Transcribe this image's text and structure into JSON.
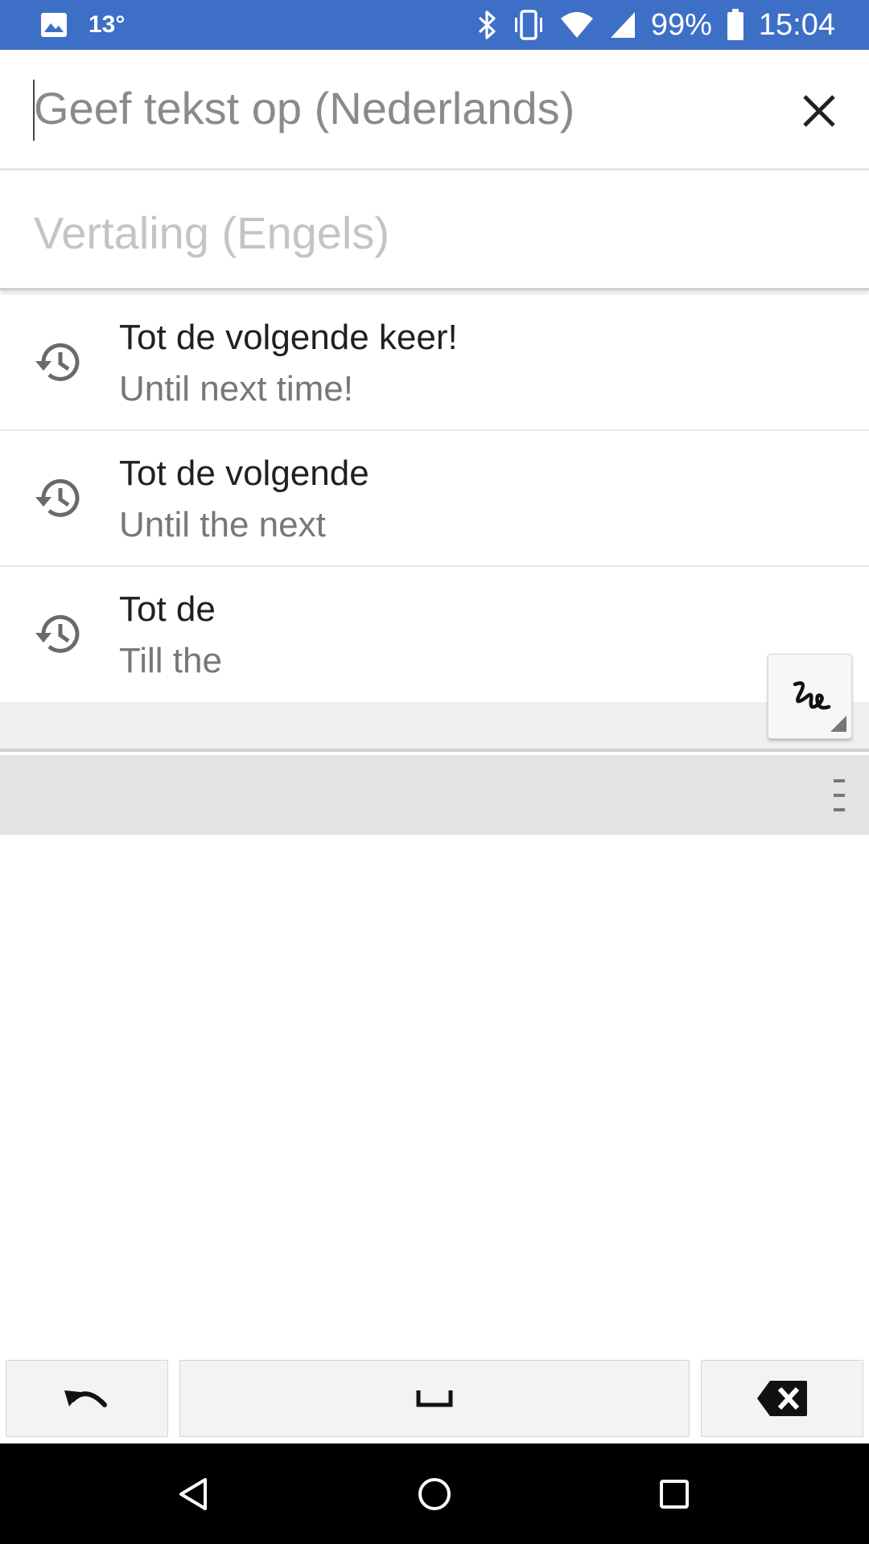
{
  "status_bar": {
    "temperature": "13°",
    "battery": "99%",
    "time": "15:04",
    "icons": [
      "image-icon",
      "bluetooth-icon",
      "vibrate-icon",
      "wifi-icon",
      "signal-icon",
      "battery-icon"
    ],
    "background_color": "#3d6fc6"
  },
  "input": {
    "placeholder": "Geef tekst op (Nederlands)",
    "value": "",
    "clear_icon": "close-icon"
  },
  "translation": {
    "placeholder": "Vertaling (Engels)"
  },
  "history": [
    {
      "source": "Tot de volgende keer!",
      "translation": "Until next time!",
      "icon": "history-icon"
    },
    {
      "source": "Tot de volgende",
      "translation": "Until the next",
      "icon": "history-icon"
    },
    {
      "source": "Tot de",
      "translation": "Till the",
      "icon": "history-icon"
    }
  ],
  "handwriting": {
    "toggle_icon": "handwriting-icon",
    "menu_icon": "menu-icon"
  },
  "keys": {
    "undo_icon": "undo-icon",
    "space_icon": "space-icon",
    "delete_icon": "backspace-icon"
  },
  "nav": {
    "back_icon": "back-icon",
    "home_icon": "home-icon",
    "recents_icon": "recents-icon"
  }
}
